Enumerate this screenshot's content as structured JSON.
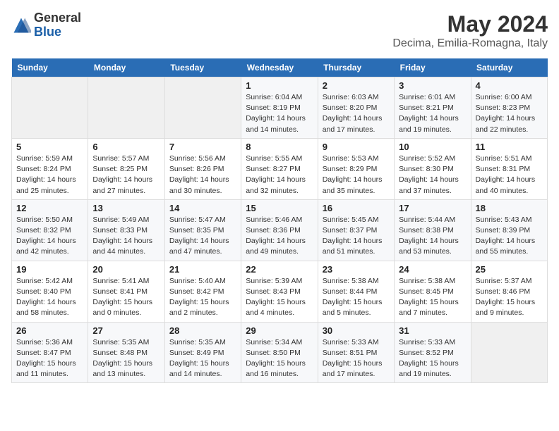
{
  "logo": {
    "general": "General",
    "blue": "Blue"
  },
  "title": "May 2024",
  "subtitle": "Decima, Emilia-Romagna, Italy",
  "days_header": [
    "Sunday",
    "Monday",
    "Tuesday",
    "Wednesday",
    "Thursday",
    "Friday",
    "Saturday"
  ],
  "weeks": [
    [
      {
        "day": "",
        "info": ""
      },
      {
        "day": "",
        "info": ""
      },
      {
        "day": "",
        "info": ""
      },
      {
        "day": "1",
        "info": "Sunrise: 6:04 AM\nSunset: 8:19 PM\nDaylight: 14 hours\nand 14 minutes."
      },
      {
        "day": "2",
        "info": "Sunrise: 6:03 AM\nSunset: 8:20 PM\nDaylight: 14 hours\nand 17 minutes."
      },
      {
        "day": "3",
        "info": "Sunrise: 6:01 AM\nSunset: 8:21 PM\nDaylight: 14 hours\nand 19 minutes."
      },
      {
        "day": "4",
        "info": "Sunrise: 6:00 AM\nSunset: 8:23 PM\nDaylight: 14 hours\nand 22 minutes."
      }
    ],
    [
      {
        "day": "5",
        "info": "Sunrise: 5:59 AM\nSunset: 8:24 PM\nDaylight: 14 hours\nand 25 minutes."
      },
      {
        "day": "6",
        "info": "Sunrise: 5:57 AM\nSunset: 8:25 PM\nDaylight: 14 hours\nand 27 minutes."
      },
      {
        "day": "7",
        "info": "Sunrise: 5:56 AM\nSunset: 8:26 PM\nDaylight: 14 hours\nand 30 minutes."
      },
      {
        "day": "8",
        "info": "Sunrise: 5:55 AM\nSunset: 8:27 PM\nDaylight: 14 hours\nand 32 minutes."
      },
      {
        "day": "9",
        "info": "Sunrise: 5:53 AM\nSunset: 8:29 PM\nDaylight: 14 hours\nand 35 minutes."
      },
      {
        "day": "10",
        "info": "Sunrise: 5:52 AM\nSunset: 8:30 PM\nDaylight: 14 hours\nand 37 minutes."
      },
      {
        "day": "11",
        "info": "Sunrise: 5:51 AM\nSunset: 8:31 PM\nDaylight: 14 hours\nand 40 minutes."
      }
    ],
    [
      {
        "day": "12",
        "info": "Sunrise: 5:50 AM\nSunset: 8:32 PM\nDaylight: 14 hours\nand 42 minutes."
      },
      {
        "day": "13",
        "info": "Sunrise: 5:49 AM\nSunset: 8:33 PM\nDaylight: 14 hours\nand 44 minutes."
      },
      {
        "day": "14",
        "info": "Sunrise: 5:47 AM\nSunset: 8:35 PM\nDaylight: 14 hours\nand 47 minutes."
      },
      {
        "day": "15",
        "info": "Sunrise: 5:46 AM\nSunset: 8:36 PM\nDaylight: 14 hours\nand 49 minutes."
      },
      {
        "day": "16",
        "info": "Sunrise: 5:45 AM\nSunset: 8:37 PM\nDaylight: 14 hours\nand 51 minutes."
      },
      {
        "day": "17",
        "info": "Sunrise: 5:44 AM\nSunset: 8:38 PM\nDaylight: 14 hours\nand 53 minutes."
      },
      {
        "day": "18",
        "info": "Sunrise: 5:43 AM\nSunset: 8:39 PM\nDaylight: 14 hours\nand 55 minutes."
      }
    ],
    [
      {
        "day": "19",
        "info": "Sunrise: 5:42 AM\nSunset: 8:40 PM\nDaylight: 14 hours\nand 58 minutes."
      },
      {
        "day": "20",
        "info": "Sunrise: 5:41 AM\nSunset: 8:41 PM\nDaylight: 15 hours\nand 0 minutes."
      },
      {
        "day": "21",
        "info": "Sunrise: 5:40 AM\nSunset: 8:42 PM\nDaylight: 15 hours\nand 2 minutes."
      },
      {
        "day": "22",
        "info": "Sunrise: 5:39 AM\nSunset: 8:43 PM\nDaylight: 15 hours\nand 4 minutes."
      },
      {
        "day": "23",
        "info": "Sunrise: 5:38 AM\nSunset: 8:44 PM\nDaylight: 15 hours\nand 5 minutes."
      },
      {
        "day": "24",
        "info": "Sunrise: 5:38 AM\nSunset: 8:45 PM\nDaylight: 15 hours\nand 7 minutes."
      },
      {
        "day": "25",
        "info": "Sunrise: 5:37 AM\nSunset: 8:46 PM\nDaylight: 15 hours\nand 9 minutes."
      }
    ],
    [
      {
        "day": "26",
        "info": "Sunrise: 5:36 AM\nSunset: 8:47 PM\nDaylight: 15 hours\nand 11 minutes."
      },
      {
        "day": "27",
        "info": "Sunrise: 5:35 AM\nSunset: 8:48 PM\nDaylight: 15 hours\nand 13 minutes."
      },
      {
        "day": "28",
        "info": "Sunrise: 5:35 AM\nSunset: 8:49 PM\nDaylight: 15 hours\nand 14 minutes."
      },
      {
        "day": "29",
        "info": "Sunrise: 5:34 AM\nSunset: 8:50 PM\nDaylight: 15 hours\nand 16 minutes."
      },
      {
        "day": "30",
        "info": "Sunrise: 5:33 AM\nSunset: 8:51 PM\nDaylight: 15 hours\nand 17 minutes."
      },
      {
        "day": "31",
        "info": "Sunrise: 5:33 AM\nSunset: 8:52 PM\nDaylight: 15 hours\nand 19 minutes."
      },
      {
        "day": "",
        "info": ""
      }
    ]
  ]
}
